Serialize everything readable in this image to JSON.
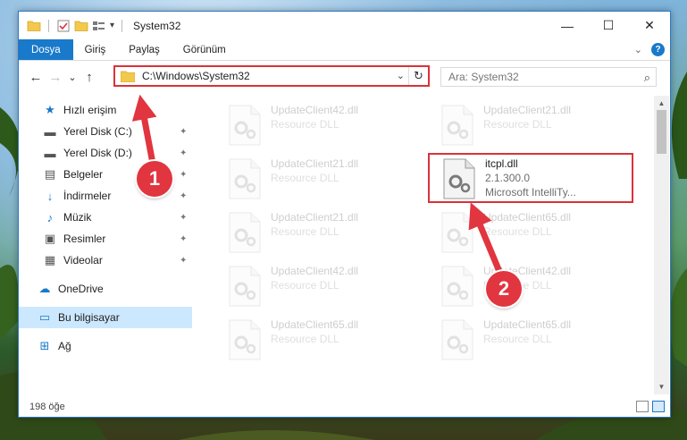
{
  "window": {
    "title": "System32",
    "controls": {
      "minimize": "—",
      "maximize": "☐",
      "close": "✕"
    }
  },
  "ribbon": {
    "tabs": [
      {
        "label": "Dosya",
        "active": true
      },
      {
        "label": "Giriş"
      },
      {
        "label": "Paylaş"
      },
      {
        "label": "Görünüm"
      }
    ]
  },
  "address": {
    "path": "C:\\Windows\\System32",
    "dropdown": "⌄",
    "refresh": "↻"
  },
  "search": {
    "placeholder": "Ara: System32",
    "icon": "⌕"
  },
  "nav": {
    "back": "←",
    "forward": "→",
    "recent": "⌄",
    "up": "↑"
  },
  "sidebar": {
    "items": [
      {
        "label": "Hızlı erişim",
        "icon": "★",
        "pinned": false
      },
      {
        "label": "Yerel Disk (C:)",
        "icon": "▬",
        "pinned": true
      },
      {
        "label": "Yerel Disk (D:)",
        "icon": "▬",
        "pinned": true
      },
      {
        "label": "Belgeler",
        "icon": "▤",
        "pinned": true
      },
      {
        "label": "İndirmeler",
        "icon": "↓",
        "pinned": true
      },
      {
        "label": "Müzik",
        "icon": "♪",
        "pinned": true
      },
      {
        "label": "Resimler",
        "icon": "▣",
        "pinned": true
      },
      {
        "label": "Videolar",
        "icon": "▦",
        "pinned": true
      },
      {
        "label": "OneDrive",
        "icon": "☁",
        "pinned": false
      },
      {
        "label": "Bu bilgisayar",
        "icon": "▭",
        "pinned": false,
        "selected": true
      },
      {
        "label": "Ağ",
        "icon": "⊞",
        "pinned": false
      }
    ],
    "pin_glyph": "📌"
  },
  "files": [
    {
      "name": "UpdateClient42.dll",
      "sub": "Resource DLL"
    },
    {
      "name": "UpdateClient21.dll",
      "sub": "Resource DLL"
    },
    {
      "name": "UpdateClient21.dll",
      "sub": "Resource DLL"
    },
    {
      "name": "itcpl.dll",
      "sub": "2.1.300.0",
      "sub2": "Microsoft IntelliTy...",
      "highlight": true
    },
    {
      "name": "UpdateClient21.dll",
      "sub": "Resource DLL"
    },
    {
      "name": "UpdateClient65.dll",
      "sub": "Resource DLL"
    },
    {
      "name": "UpdateClient42.dll",
      "sub": "Resource DLL"
    },
    {
      "name": "UpdateClient42.dll",
      "sub": "Resource DLL"
    },
    {
      "name": "UpdateClient65.dll",
      "sub": "Resource DLL"
    },
    {
      "name": "UpdateClient65.dll",
      "sub": "Resource DLL"
    }
  ],
  "status": {
    "count": "198 öğe"
  },
  "annotations": {
    "callout1": "1",
    "callout2": "2"
  },
  "colors": {
    "accent": "#1979ca",
    "highlight": "#d9323a",
    "callout": "#e1353f"
  }
}
